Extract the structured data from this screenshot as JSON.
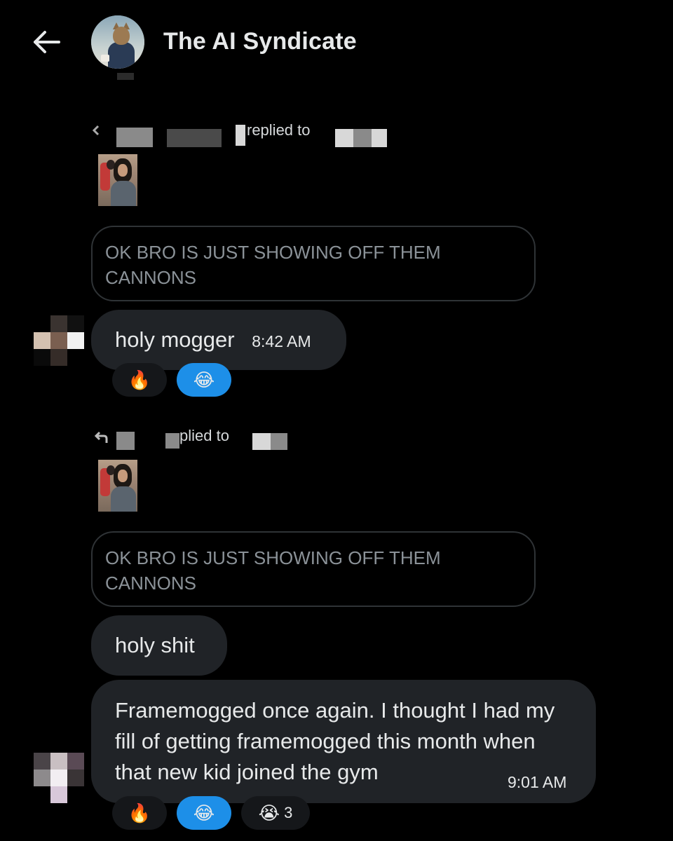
{
  "header": {
    "title": "The AI Syndicate"
  },
  "messages": [
    {
      "reply_label": "replied to",
      "quoted_text": "OK BRO IS JUST SHOWING OFF THEM CANNONS",
      "text": "holy mogger",
      "time": "8:42 AM",
      "reactions": [
        {
          "emoji": "🔥",
          "active": false
        },
        {
          "emoji": "😂",
          "active": true
        }
      ]
    },
    {
      "reply_label": "plied to",
      "quoted_text": "OK BRO IS JUST SHOWING OFF THEM CANNONS",
      "text": "holy shit"
    },
    {
      "text": "Framemogged once again. I thought I had my fill of getting framemogged this month when that new kid joined the gym",
      "time": "9:01 AM",
      "reactions": [
        {
          "emoji": "🔥",
          "active": false
        },
        {
          "emoji": "😂",
          "active": true
        },
        {
          "emoji": "😭",
          "active": false,
          "count": "3"
        }
      ]
    }
  ],
  "colors": {
    "background": "#000000",
    "bubble": "#202327",
    "quote_border": "#2f3336",
    "reaction_active": "#1d8fe8"
  },
  "icons": {
    "back": "arrow-left-icon",
    "reply": "reply-arrow-icon"
  }
}
